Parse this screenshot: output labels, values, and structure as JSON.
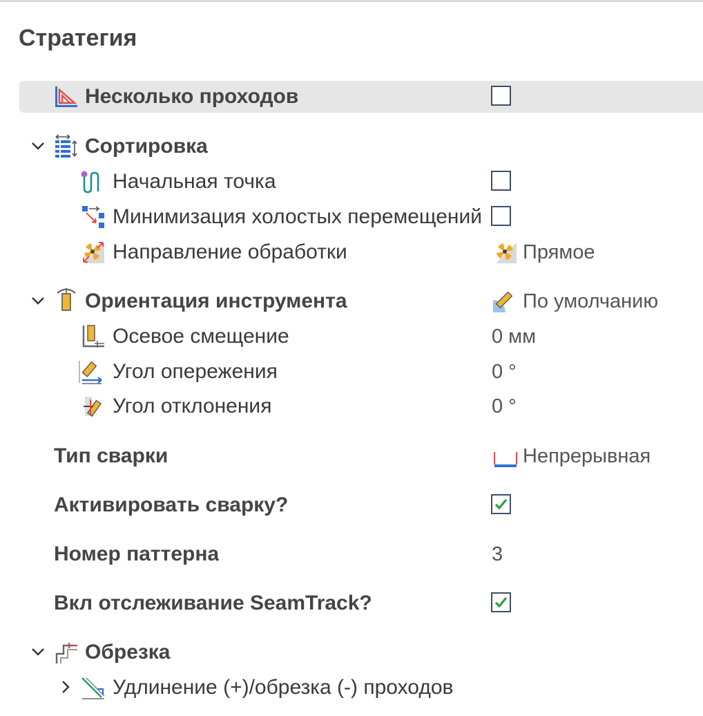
{
  "panel": {
    "title": "Стратегия"
  },
  "rows": {
    "multi_pass": {
      "label": "Несколько проходов",
      "checked": false
    },
    "sorting": {
      "label": "Сортировка",
      "expanded": true
    },
    "start_point": {
      "label": "Начальная точка",
      "checked": false
    },
    "min_idle": {
      "label": "Минимизация холостых перемещений",
      "checked": false
    },
    "direction": {
      "label": "Направление обработки",
      "value": "Прямое"
    },
    "tool_orient": {
      "label": "Ориентация инструмента",
      "expanded": true,
      "value": "По умолчанию"
    },
    "axial_offset": {
      "label": "Осевое смещение",
      "value": "0 мм"
    },
    "lead_angle": {
      "label": "Угол опережения",
      "value": "0 °"
    },
    "tilt_angle": {
      "label": "Угол отклонения",
      "value": "0 °"
    },
    "weld_type": {
      "label": "Тип сварки",
      "value": "Непрерывная"
    },
    "activate_weld": {
      "label": "Активировать сварку?",
      "checked": true
    },
    "pattern_number": {
      "label": "Номер паттерна",
      "value": "3"
    },
    "seamtrack": {
      "label": "Вкл отслеживание SeamTrack?",
      "checked": true
    },
    "trim": {
      "label": "Обрезка",
      "expanded": true
    },
    "extend_trim": {
      "label": "Удлинение (+)/обрезка (-) проходов",
      "expanded": false
    }
  },
  "colors": {
    "accent_blue": "#1f6fd1",
    "check_green": "#2e9e3e",
    "highlight_row": "#e6e6e6",
    "tool_yellow": "#f2b632"
  }
}
